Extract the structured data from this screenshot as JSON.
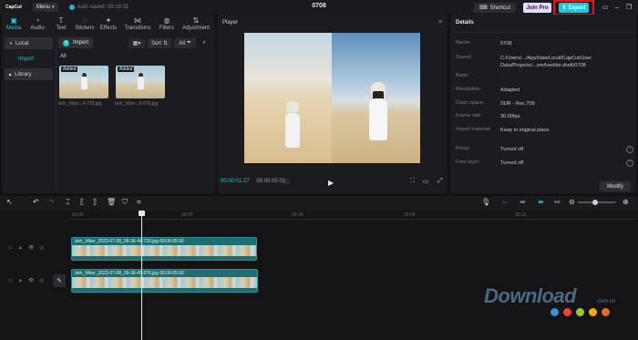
{
  "app": {
    "logo": "CapCut",
    "menu_label": "Menu",
    "autosave_text": "Auto saved: 09:18:31",
    "project_title": "0708",
    "shortcut_label": "Shortcut",
    "joinpro_label": "Join Pro",
    "export_label": "Export"
  },
  "media_tabs": [
    {
      "label": "Media",
      "icon": "media-icon"
    },
    {
      "label": "Audio",
      "icon": "audio-icon"
    },
    {
      "label": "Text",
      "icon": "text-icon"
    },
    {
      "label": "Stickers",
      "icon": "stickers-icon"
    },
    {
      "label": "Effects",
      "icon": "effects-icon"
    },
    {
      "label": "Transitions",
      "icon": "transitions-icon"
    },
    {
      "label": "Filters",
      "icon": "filters-icon"
    },
    {
      "label": "Adjustment",
      "icon": "adjustment-icon"
    }
  ],
  "side_nav": {
    "local": "Local",
    "import": "Import",
    "library": "Library"
  },
  "media_toolbar": {
    "import_label": "Import",
    "sort_label": "Sort",
    "all_label": "All"
  },
  "media": {
    "section_label": "All",
    "items": [
      {
        "badge": "Added",
        "name": "ảnh_Viber...4-733.jpg"
      },
      {
        "badge": "Added",
        "name": "ảnh_Viber...5-076.jpg"
      }
    ]
  },
  "player": {
    "title": "Player",
    "current_time": "00:00:01:27",
    "total_time": "00:00:05:01"
  },
  "details": {
    "title": "Details",
    "rows": [
      {
        "key": "Name:",
        "value": "0708"
      },
      {
        "key": "Saved:",
        "value": "C:/Users/.../AppData/Local/CapCut/User Data/Projects/...om/lveditor.draft/0708"
      },
      {
        "key": "Ratio:",
        "value": ""
      },
      {
        "key": "Resolution:",
        "value": "Adapted"
      },
      {
        "key": "Color space:",
        "value": "SDR - Rec.709"
      },
      {
        "key": "Frame rate:",
        "value": "30.00fps"
      },
      {
        "key": "Import material:",
        "value": "Keep in original place"
      },
      {
        "key": "Proxy:",
        "value": "Turned off"
      },
      {
        "key": "Free layer:",
        "value": "Turned off"
      }
    ],
    "modify_label": "Modify"
  },
  "timeline": {
    "ruler": [
      "00:00",
      "00:03",
      "00:06",
      "00:09",
      "00:12"
    ],
    "clips": [
      {
        "label": "ảnh_Viber_2023-07-08_09-36-44-733.jpg  00:00:05:00"
      },
      {
        "label": "ảnh_Viber_2023-07-08_09-36-45-076.jpg  00:00:05:00"
      }
    ]
  },
  "watermark": {
    "brand": "Download",
    "domain": ".com.vn",
    "dot_colors": [
      "#3a8fd6",
      "#e8443a",
      "#9cc33b",
      "#f2a51d",
      "#e06b2a"
    ]
  },
  "colors": {
    "accent": "#20c7d4",
    "highlight": "#e3141b",
    "pro": "#e8d9ff"
  }
}
